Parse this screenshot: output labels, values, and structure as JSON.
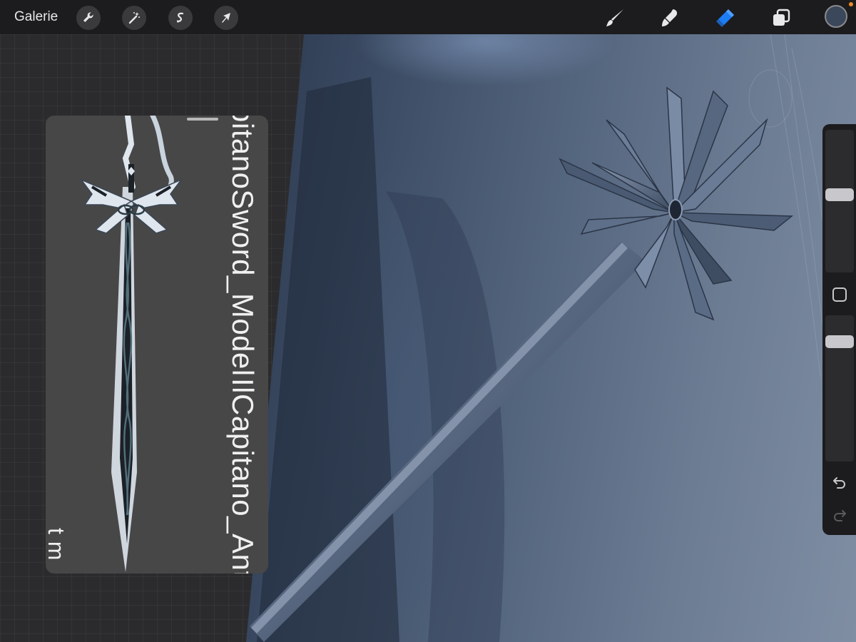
{
  "topbar": {
    "gallery_label": "Galerie",
    "left_tools": [
      {
        "icon": "wrench-icon",
        "name": "actions"
      },
      {
        "icon": "magic-wand-icon",
        "name": "adjustments"
      },
      {
        "icon": "selection-icon",
        "name": "selection"
      },
      {
        "icon": "arrow-cursor-icon",
        "name": "transform"
      }
    ],
    "right_tools": [
      {
        "icon": "brush-icon",
        "name": "paint"
      },
      {
        "icon": "smudge-icon",
        "name": "smudge"
      },
      {
        "icon": "eraser-icon",
        "name": "erase",
        "active": true
      },
      {
        "icon": "layers-icon",
        "name": "layers"
      }
    ],
    "current_color": "#3b475a",
    "indicator_color": "#f08a24",
    "active_color": "#1c7cf4"
  },
  "reference": {
    "text_1": "pitanoSword_Model",
    "text_2": "IlCapitano_Antumb",
    "text_3": "t m"
  },
  "sidebar": {
    "brush_size": 0.55,
    "brush_opacity": 0.85
  }
}
